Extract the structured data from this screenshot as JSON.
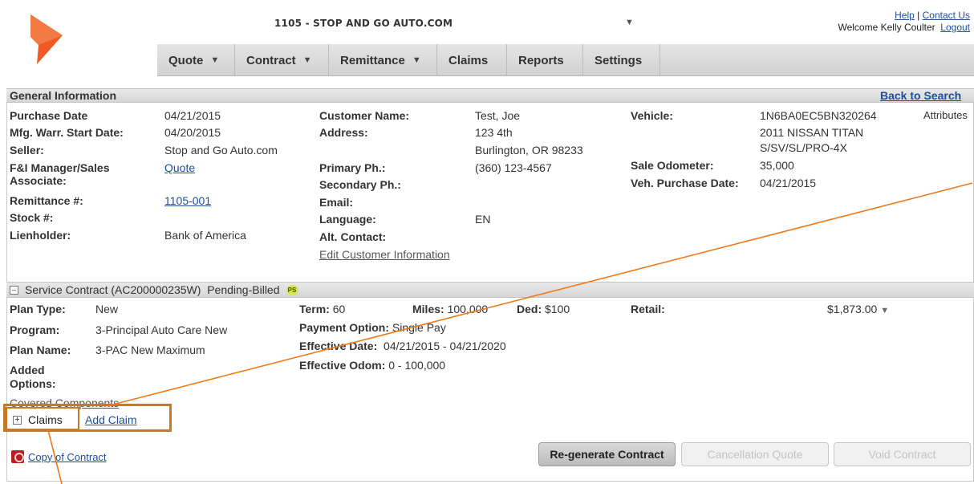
{
  "header": {
    "dealer": "1105 - STOP AND GO AUTO.COM",
    "help": "Help",
    "separator": "|",
    "contact": "Contact Us",
    "welcome": "Welcome Kelly Coulter",
    "logout": "Logout"
  },
  "nav": [
    {
      "label": "Quote",
      "caret": true
    },
    {
      "label": "Contract",
      "caret": true
    },
    {
      "label": "Remittance",
      "caret": true
    },
    {
      "label": "Claims",
      "caret": false
    },
    {
      "label": "Reports",
      "caret": false
    },
    {
      "label": "Settings",
      "caret": false
    }
  ],
  "general": {
    "title": "General Information",
    "back": "Back to Search",
    "purchase_date_label": "Purchase Date",
    "purchase_date": "04/21/2015",
    "mfg_label": "Mfg. Warr. Start Date:",
    "mfg": "04/20/2015",
    "seller_label": "Seller:",
    "seller": "Stop and Go Auto.com",
    "fi_label_1": "F&I Manager/Sales",
    "fi_label_2": "Associate:",
    "fi": "Quote",
    "remit_label": "Remittance #:",
    "remit": "1105-001",
    "stock_label": "Stock #:",
    "lien_label": "Lienholder:",
    "lien": "Bank of America",
    "cust_label": "Customer Name:",
    "cust": "Test, Joe",
    "addr_label": "Address:",
    "addr1": "123 4th",
    "addr2": "Burlington, OR 98233",
    "primary_label": "Primary Ph.:",
    "primary": "(360) 123-4567",
    "secondary_label": "Secondary Ph.:",
    "email_label": "Email:",
    "lang_label": "Language:",
    "lang": "EN",
    "alt_label": "Alt. Contact:",
    "edit_cust": "Edit Customer Information",
    "vehicle_label": "Vehicle:",
    "vin": "1N6BA0EC5BN320264",
    "attributes": "Attributes",
    "veh1": "2011 NISSAN TITAN",
    "veh2": "S/SV/SL/PRO-4X",
    "odo_label": "Sale Odometer:",
    "odo": "35,000",
    "vpd_label": "Veh. Purchase Date:",
    "vpd": "04/21/2015"
  },
  "contract": {
    "toggle": "⊟",
    "title": "Service Contract (AC200000235W)",
    "status": "Pending-Billed",
    "badge": "PS",
    "plan_type_label": "Plan Type:",
    "plan_type": "New",
    "program_label": "Program:",
    "program": "3-Principal Auto Care New",
    "plan_name_label": "Plan Name:",
    "plan_name": "3-PAC New Maximum",
    "added_label_1": "Added",
    "added_label_2": "Options:",
    "term_label": "Term:",
    "term": "60",
    "miles_label": "Miles:",
    "miles": "100,000",
    "ded_label": "Ded:",
    "ded": "$100",
    "payment_label": "Payment Option:",
    "payment": "Single Pay",
    "eff_date_label": "Effective Date:",
    "eff_date": "04/21/2015 - 04/21/2020",
    "eff_odom_label": "Effective Odom:",
    "eff_odom": "0 - 100,000",
    "retail_label": "Retail:",
    "retail": "$1,873.00",
    "retail_caret": "▼",
    "covered": "Covered Components",
    "claims_toggle": "⊞",
    "claims": "Claims",
    "add_claim": "Add Claim",
    "copy": "Copy of Contract"
  },
  "buttons": {
    "regen": "Re-generate Contract",
    "cancel": "Cancellation Quote",
    "void": "Void Contract"
  },
  "colors": {
    "brand": "#ef5a24",
    "annotation": "#c37a2a",
    "link": "#1f4e9c"
  }
}
